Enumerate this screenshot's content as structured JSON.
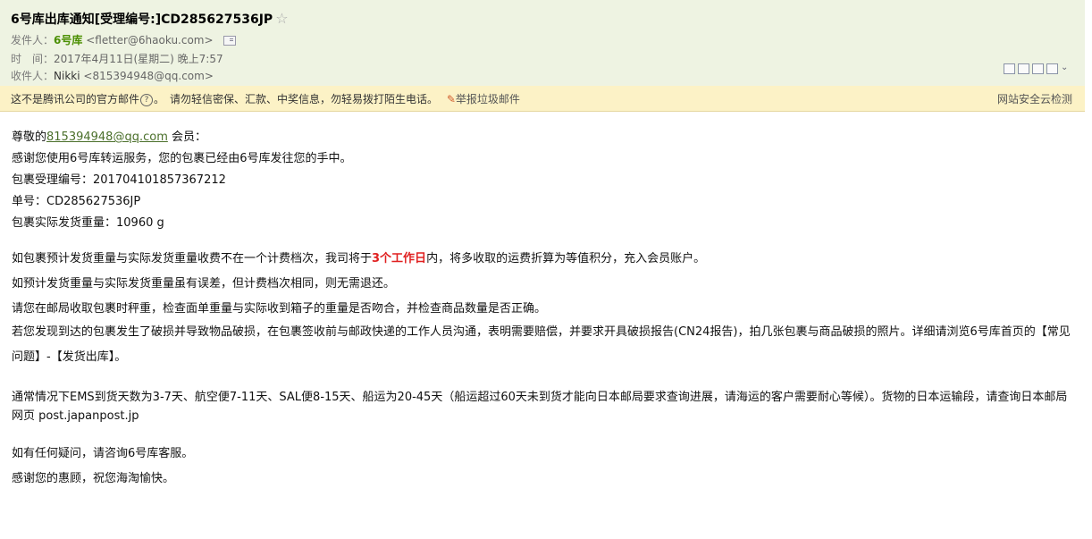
{
  "header": {
    "subject": "6号库出库通知[受理编号:]CD285627536JP",
    "from_label": "发件人：",
    "sender_name": "6号库",
    "sender_email": "<fletter@6haoku.com>",
    "time_label": "时　间：",
    "time_value": "2017年4月11日(星期二) 晚上7:57",
    "to_label": "收件人：",
    "recipient_name": "Nikki",
    "recipient_email": "<815394948@qq.com>"
  },
  "warning": {
    "text1": "这不是腾讯公司的官方邮件",
    "q": "?",
    "text2": "。　请勿轻信密保、汇款、中奖信息，勿轻易拨打陌生电话。",
    "report_label": "举报垃圾邮件",
    "security_check": "网站安全云检测"
  },
  "body": {
    "greeting_prefix": "尊敬的",
    "greeting_email": "815394948@qq.com",
    "greeting_suffix": " 会员：",
    "line1": "感谢您使用6号库转运服务，您的包裹已经由6号库发往您的手中。",
    "line2": "包裹受理编号：201704101857367212",
    "line3": "单号：CD285627536JP",
    "line4": "包裹实际发货重量：10960 g",
    "para1_a": "如包裹预计发货重量与实际发货重量收费不在一个计费档次，我司将于",
    "para1_red": "3个工作日",
    "para1_b": "内，将多收取的运费折算为等值积分，充入会员账户。",
    "para2": "如预计发货重量与实际发货重量虽有误差，但计费档次相同，则无需退还。",
    "para3": "请您在邮局收取包裹时秤重，检查面单重量与实际收到箱子的重量是否吻合，并检查商品数量是否正确。",
    "para4": "若您发现到达的包裹发生了破损并导致物品破损，在包裹签收前与邮政快递的工作人员沟通，表明需要赔偿，并要求开具破损报告(CN24报告)，拍几张包裹与商品破损的照片。详细请浏览6号库首页的【常见问题】-【发货出库】。",
    "para5": "通常情况下EMS到货天数为3-7天、航空便7-11天、SAL便8-15天、船运为20-45天（船运超过60天未到货才能向日本邮局要求查询进展，请海运的客户需要耐心等候）。货物的日本运输段，请查询日本邮局网页 post.japanpost.jp",
    "para6": "如有任何疑问，请咨询6号库客服。",
    "para7": "感谢您的惠顾，祝您海淘愉快。"
  }
}
